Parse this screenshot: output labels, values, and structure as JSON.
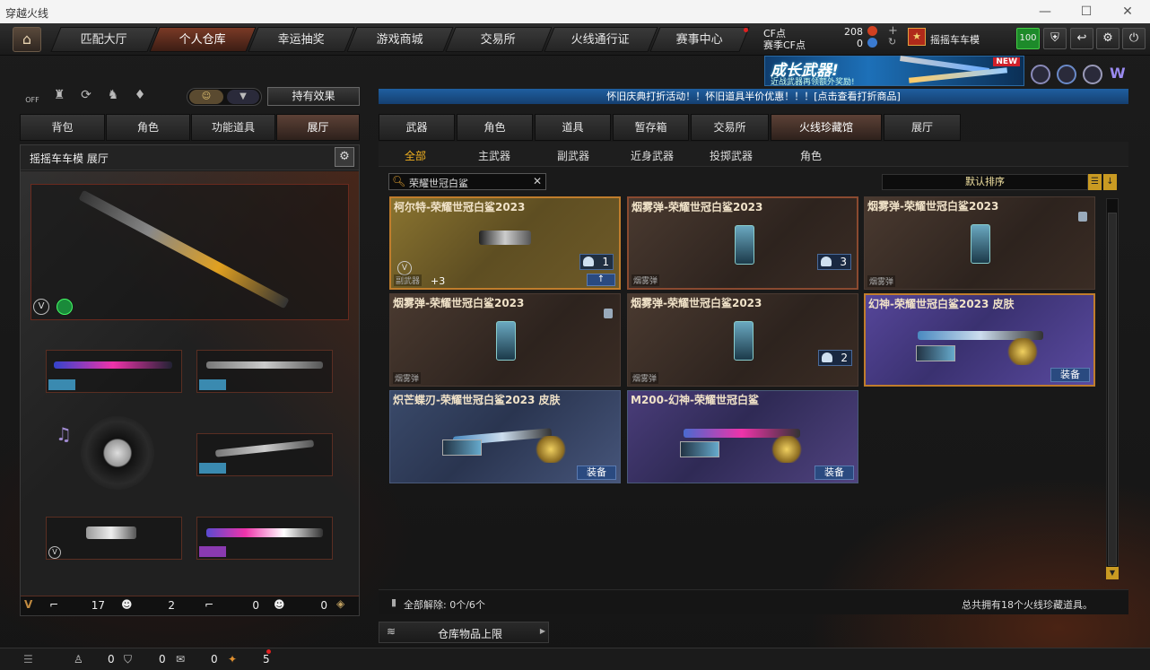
{
  "window": {
    "title": "穿越火线",
    "min": "—",
    "max": "☐",
    "close": "✕"
  },
  "nav": {
    "tabs": [
      "匹配大厅",
      "个人仓库",
      "幸运抽奖",
      "游戏商城",
      "交易所",
      "火线通行证",
      "赛事中心"
    ],
    "active": 1
  },
  "currency": {
    "cf_label": "CF点",
    "cf_value": "208",
    "season_label": "赛季CF点",
    "season_value": "0",
    "plus": "+",
    "refresh": "↻"
  },
  "user": {
    "name": "摇摇车车模",
    "level": "100"
  },
  "banner": {
    "title": "成长武器!",
    "subtitle": "近战武器再领额外奖励!",
    "new": "NEW"
  },
  "left": {
    "hold_effect": "持有效果",
    "off_label": "OFF",
    "tabs": [
      "背包",
      "角色",
      "功能道具",
      "展厅"
    ],
    "active_tab": 3,
    "header": "摇摇车车模 展厅",
    "stats": [
      {
        "value": "17"
      },
      {
        "value": "2"
      },
      {
        "value": "0"
      },
      {
        "value": "0"
      }
    ]
  },
  "notice": "怀旧庆典打折活动！！怀旧道具半价优惠！！！[点击查看打折商品]",
  "right": {
    "tabs": [
      "武器",
      "角色",
      "道具",
      "暂存箱",
      "交易所",
      "火线珍藏馆",
      "展厅"
    ],
    "active_tab": 5,
    "subtabs": [
      "全部",
      "主武器",
      "副武器",
      "近身武器",
      "投掷武器",
      "角色"
    ],
    "active_sub": 0,
    "search_value": "荣耀世冠白鲨",
    "sort_label": "默认排序",
    "items": [
      {
        "name": "柯尔特-荣耀世冠白鲨2023",
        "tag": "副武器",
        "count": "1",
        "extra": "+3"
      },
      {
        "name": "烟雾弹-荣耀世冠白鲨2023",
        "tag": "烟雾弹",
        "count": "3"
      },
      {
        "name": "烟雾弹-荣耀世冠白鲨2023",
        "tag": "烟雾弹"
      },
      {
        "name": "烟雾弹-荣耀世冠白鲨2023",
        "tag": "烟雾弹"
      },
      {
        "name": "烟雾弹-荣耀世冠白鲨2023",
        "tag": "烟雾弹",
        "count": "2"
      },
      {
        "name": "幻神-荣耀世冠白鲨2023 皮肤",
        "equip": "装备",
        "badge": "CF赛事 电竞荣誉"
      },
      {
        "name": "炽芒蝶刃-荣耀世冠白鲨2023 皮肤",
        "equip": "装备",
        "badge": "CF赛事 电竞荣誉"
      },
      {
        "name": "M200-幻神-荣耀世冠白鲨",
        "equip": "装备",
        "badge": "CF赛事 电竞荣誉"
      }
    ],
    "unlock_text": "全部解除: 0个/6个",
    "total_text": "总共拥有18个火线珍藏道具。",
    "capacity": "仓库物品上限"
  },
  "statusbar": {
    "a": "0",
    "b": "0",
    "c": "0",
    "d": "5"
  }
}
